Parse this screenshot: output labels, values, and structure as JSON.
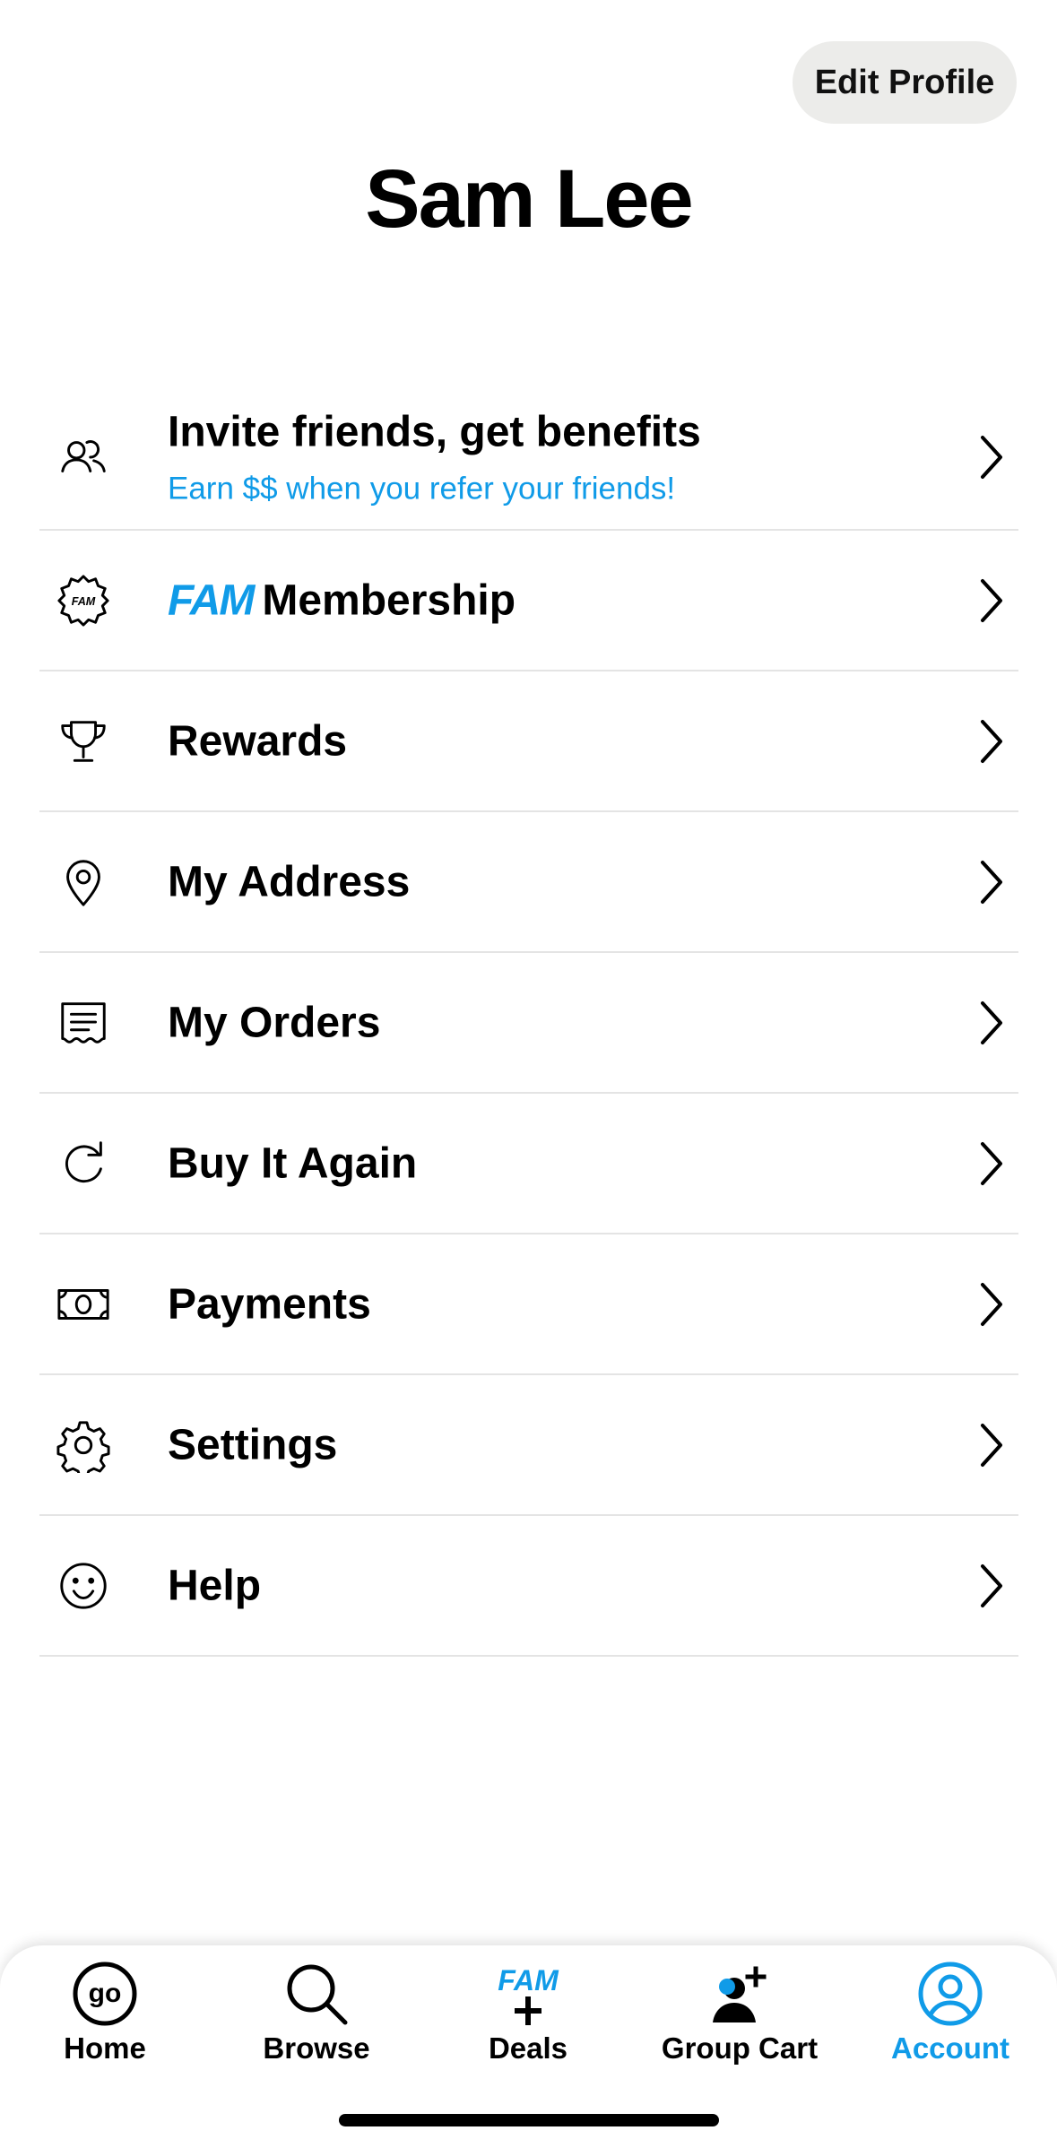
{
  "header": {
    "edit_profile_label": "Edit Profile",
    "user_name": "Sam Lee"
  },
  "menu": {
    "invite": {
      "label": "Invite friends, get benefits",
      "sublabel": "Earn $$ when you refer your friends!",
      "icon": "people-icon"
    },
    "membership": {
      "fam_word": "FAM",
      "label": "Membership",
      "icon": "fam-badge-icon",
      "badge_text": "FAM"
    },
    "rewards": {
      "label": "Rewards",
      "icon": "trophy-icon"
    },
    "address": {
      "label": "My Address",
      "icon": "location-pin-icon"
    },
    "orders": {
      "label": "My Orders",
      "icon": "receipt-icon"
    },
    "buy_again": {
      "label": "Buy It Again",
      "icon": "refresh-icon"
    },
    "payments": {
      "label": "Payments",
      "icon": "cash-icon"
    },
    "settings": {
      "label": "Settings",
      "icon": "gear-icon"
    },
    "help": {
      "label": "Help",
      "icon": "smiley-icon"
    }
  },
  "tabbar": {
    "home": {
      "label": "Home",
      "logo_text": "go"
    },
    "browse": {
      "label": "Browse"
    },
    "deals": {
      "label": "Deals",
      "logo_text": "FAM"
    },
    "group_cart": {
      "label": "Group Cart"
    },
    "account": {
      "label": "Account",
      "active": true
    }
  },
  "colors": {
    "accent": "#109be8",
    "button_bg": "#ececea",
    "divider": "#e4e4e4"
  }
}
